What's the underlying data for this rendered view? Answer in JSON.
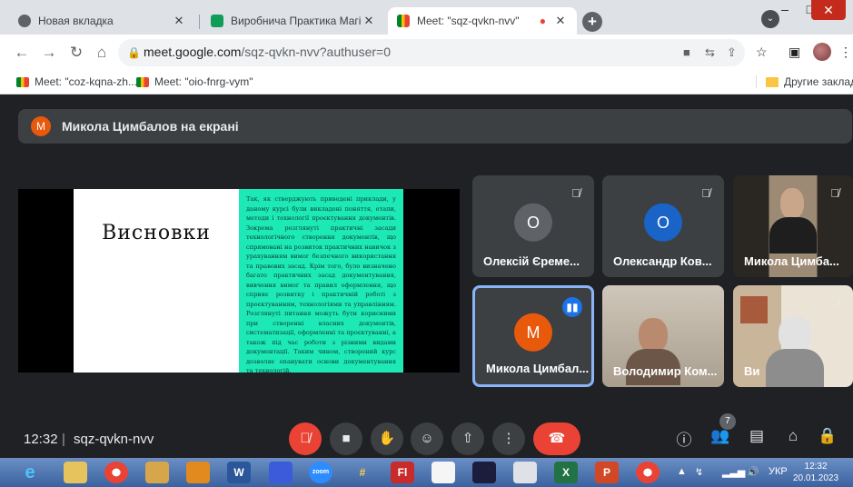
{
  "browser": {
    "tabs": [
      {
        "title": "Новая вкладка"
      },
      {
        "title": "Виробнича Практика Магістри"
      },
      {
        "title": "Meet: \"sqz-qvkn-nvv\""
      }
    ],
    "url_host": "meet.google.com",
    "url_path": "/sqz-qvkn-nvv?authuser=0",
    "bookmarks": [
      {
        "label": "Meet: \"coz-kqna-zh..."
      },
      {
        "label": "Meet: \"oio-fnrg-vym\""
      }
    ],
    "other_bookmarks": "Другие закладки"
  },
  "meet": {
    "presenting_initial": "М",
    "presenting_text": "Микола Цимбалов на екрані",
    "slide": {
      "title": "Висновки",
      "body": "Так, як стверджують приведені приклади, у даному курсі були викладені поняття, етапи, методи і технології проєктування документів. Зокрема розглянуті практичні засади технологічного створення документів, що спрямовані на розвиток практичних навичок з урахуванням вимог безпечного використання та правових засад. Крім того, було визначено багато практичних засад документування, вивчення вимог та правил оформлення, що сприяє розвитку і практичній роботі з проєктуванням, технологіями та управлінням. Розглянуті питання можуть бути корисними при створенні власних документів, систематизації, оформленні та проєктуванні, а також під час роботи з різними видами документації. Таким чином, створений курс дозволяє опанувати основи документування та технологій."
    },
    "participants": [
      {
        "name": "Олексій Єреме...",
        "initial": "О",
        "color": "#5f6368"
      },
      {
        "name": "Олександр Ков...",
        "initial": "О",
        "color": "#1a63c7"
      },
      {
        "name": "Микола Цимба..."
      },
      {
        "name": "Микола Цимбал...",
        "initial": "М",
        "color": "#e8590c"
      },
      {
        "name": "Володимир Ком..."
      },
      {
        "name": "Ви"
      }
    ],
    "time": "12:32",
    "code": "sqz-qvkn-nvv",
    "people_count": "7"
  },
  "taskbar": {
    "lang": "УКР",
    "time": "12:32",
    "date": "20.01.2023"
  }
}
